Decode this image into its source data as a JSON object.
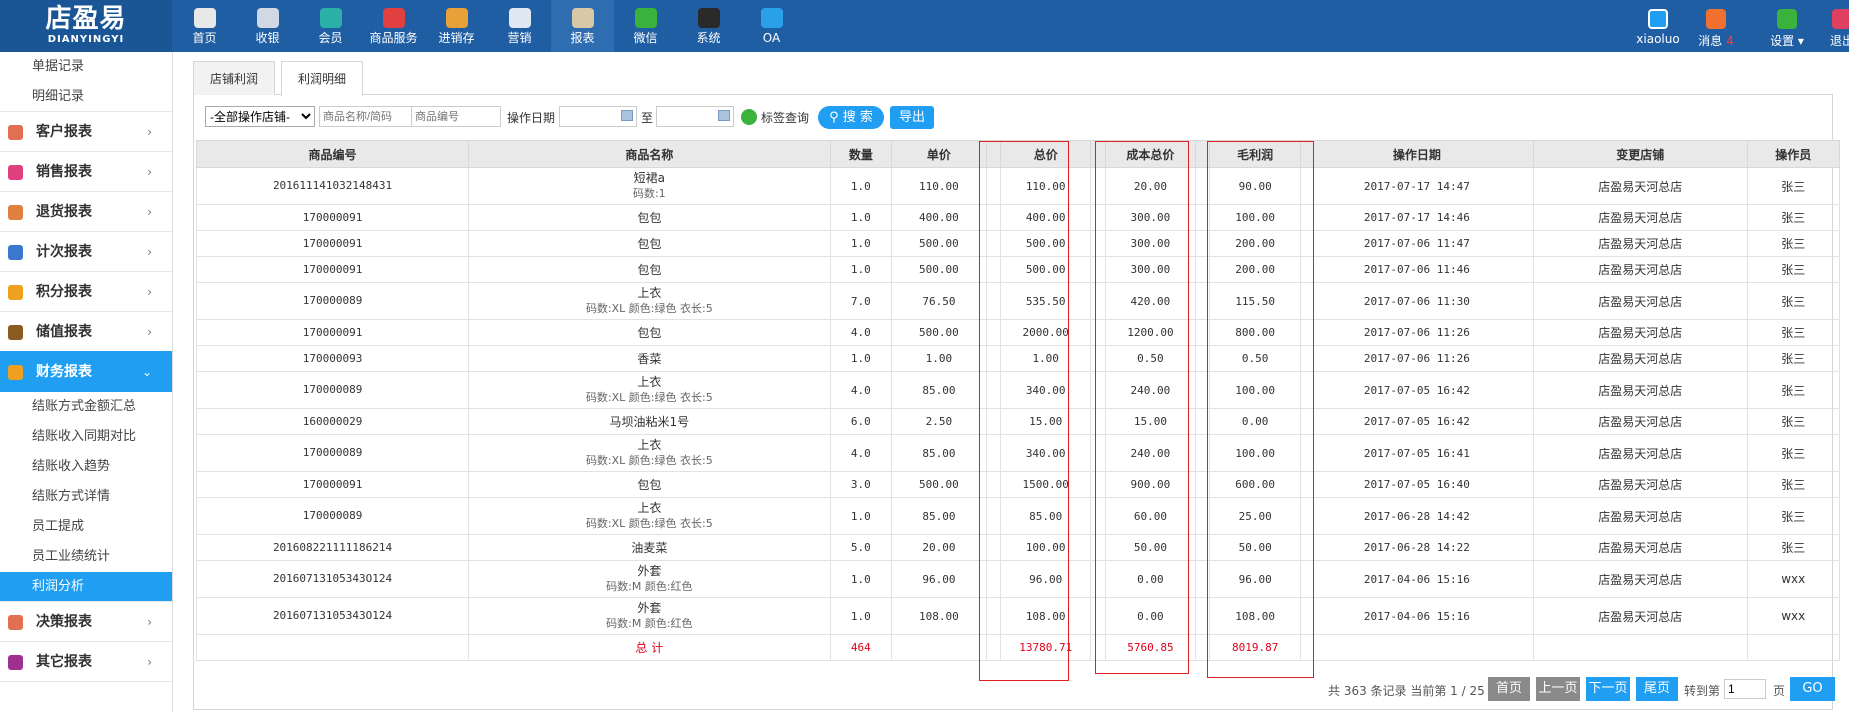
{
  "logo": {
    "cn": "店盈易",
    "en": "DIANYINGYI"
  },
  "nav": [
    {
      "label": "首页",
      "icon": "home-icon",
      "color": "#e8e8e8"
    },
    {
      "label": "收银",
      "icon": "cashier-icon",
      "color": "#cfd8e3"
    },
    {
      "label": "会员",
      "icon": "member-icon",
      "color": "#2bb0a8"
    },
    {
      "label": "商品服务",
      "icon": "goods-icon",
      "color": "#e04040"
    },
    {
      "label": "进销存",
      "icon": "inventory-icon",
      "color": "#e8a038"
    },
    {
      "label": "营销",
      "icon": "megaphone-icon",
      "color": "#dfe8f3"
    },
    {
      "label": "报表",
      "icon": "report-icon",
      "color": "#d8c8a8"
    },
    {
      "label": "微信",
      "icon": "wechat-icon",
      "color": "#3bb23b"
    },
    {
      "label": "系统",
      "icon": "monitor-icon",
      "color": "#2a2a2a"
    },
    {
      "label": "OA",
      "icon": "oa-icon",
      "color": "#2aa0e8"
    }
  ],
  "right": {
    "user": "xiaoluo",
    "msg": "消息",
    "msg_count": "4",
    "settings": "设置",
    "logout": "退出"
  },
  "sidebar": {
    "top_subs": [
      "单据记录",
      "明细记录"
    ],
    "groups": [
      {
        "label": "客户报表",
        "icon": "customer-report-icon",
        "color": "#e07050"
      },
      {
        "label": "销售报表",
        "icon": "sales-report-icon",
        "color": "#e04080"
      },
      {
        "label": "退货报表",
        "icon": "return-report-icon",
        "color": "#e08040"
      },
      {
        "label": "计次报表",
        "icon": "count-report-icon",
        "color": "#3a78d0"
      },
      {
        "label": "积分报表",
        "icon": "points-report-icon",
        "color": "#f0a020"
      },
      {
        "label": "储值报表",
        "icon": "stored-value-report-icon",
        "color": "#8a5a20"
      },
      {
        "label": "财务报表",
        "icon": "finance-report-icon",
        "color": "#f0a020"
      }
    ],
    "finance_subs": [
      "结账方式金额汇总",
      "结账收入同期对比",
      "结账收入趋势",
      "结账方式详情",
      "员工提成",
      "员工业绩统计",
      "利润分析"
    ],
    "bottom_groups": [
      {
        "label": "决策报表",
        "icon": "decision-report-icon",
        "color": "#e07050"
      },
      {
        "label": "其它报表",
        "icon": "other-report-icon",
        "color": "#a03090"
      }
    ]
  },
  "tabs": [
    "店铺利润",
    "利润明细"
  ],
  "filter": {
    "store": "-全部操作店铺-",
    "name_ph": "商品名称/简码",
    "code_ph": "商品编号",
    "date_label": "操作日期",
    "to": "至",
    "tag": "标签查询",
    "search": "搜 索",
    "export": "导出"
  },
  "table": {
    "headers": [
      "商品编号",
      "商品名称",
      "数量",
      "单价",
      "",
      "总价",
      "",
      "成本总价",
      "",
      "毛利润",
      "操作日期",
      "变更店铺",
      "操作员"
    ],
    "rows": [
      {
        "code": "201611141032148431",
        "name": "短裙a",
        "note": "码数:1",
        "qty": "1.0",
        "price": "110.00",
        "total": "110.00",
        "cost": "20.00",
        "profit": "90.00",
        "date": "2017-07-17 14:47",
        "store": "店盈易天河总店",
        "op": "张三"
      },
      {
        "code": "170000091",
        "name": "包包",
        "note": "",
        "qty": "1.0",
        "price": "400.00",
        "total": "400.00",
        "cost": "300.00",
        "profit": "100.00",
        "date": "2017-07-17 14:46",
        "store": "店盈易天河总店",
        "op": "张三"
      },
      {
        "code": "170000091",
        "name": "包包",
        "note": "",
        "qty": "1.0",
        "price": "500.00",
        "total": "500.00",
        "cost": "300.00",
        "profit": "200.00",
        "date": "2017-07-06 11:47",
        "store": "店盈易天河总店",
        "op": "张三"
      },
      {
        "code": "170000091",
        "name": "包包",
        "note": "",
        "qty": "1.0",
        "price": "500.00",
        "total": "500.00",
        "cost": "300.00",
        "profit": "200.00",
        "date": "2017-07-06 11:46",
        "store": "店盈易天河总店",
        "op": "张三"
      },
      {
        "code": "170000089",
        "name": "上衣",
        "note": "码数:XL 颜色:绿色 衣长:5",
        "qty": "7.0",
        "price": "76.50",
        "total": "535.50",
        "cost": "420.00",
        "profit": "115.50",
        "date": "2017-07-06 11:30",
        "store": "店盈易天河总店",
        "op": "张三"
      },
      {
        "code": "170000091",
        "name": "包包",
        "note": "",
        "qty": "4.0",
        "price": "500.00",
        "total": "2000.00",
        "cost": "1200.00",
        "profit": "800.00",
        "date": "2017-07-06 11:26",
        "store": "店盈易天河总店",
        "op": "张三"
      },
      {
        "code": "170000093",
        "name": "香菜",
        "note": "",
        "qty": "1.0",
        "price": "1.00",
        "total": "1.00",
        "cost": "0.50",
        "profit": "0.50",
        "date": "2017-07-06 11:26",
        "store": "店盈易天河总店",
        "op": "张三"
      },
      {
        "code": "170000089",
        "name": "上衣",
        "note": "码数:XL 颜色:绿色 衣长:5",
        "qty": "4.0",
        "price": "85.00",
        "total": "340.00",
        "cost": "240.00",
        "profit": "100.00",
        "date": "2017-07-05 16:42",
        "store": "店盈易天河总店",
        "op": "张三"
      },
      {
        "code": "160000029",
        "name": "马坝油粘米1号",
        "note": "",
        "qty": "6.0",
        "price": "2.50",
        "total": "15.00",
        "cost": "15.00",
        "profit": "0.00",
        "date": "2017-07-05 16:42",
        "store": "店盈易天河总店",
        "op": "张三"
      },
      {
        "code": "170000089",
        "name": "上衣",
        "note": "码数:XL 颜色:绿色 衣长:5",
        "qty": "4.0",
        "price": "85.00",
        "total": "340.00",
        "cost": "240.00",
        "profit": "100.00",
        "date": "2017-07-05 16:41",
        "store": "店盈易天河总店",
        "op": "张三"
      },
      {
        "code": "170000091",
        "name": "包包",
        "note": "",
        "qty": "3.0",
        "price": "500.00",
        "total": "1500.00",
        "cost": "900.00",
        "profit": "600.00",
        "date": "2017-07-05 16:40",
        "store": "店盈易天河总店",
        "op": "张三"
      },
      {
        "code": "170000089",
        "name": "上衣",
        "note": "码数:XL 颜色:绿色 衣长:5",
        "qty": "1.0",
        "price": "85.00",
        "total": "85.00",
        "cost": "60.00",
        "profit": "25.00",
        "date": "2017-06-28 14:42",
        "store": "店盈易天河总店",
        "op": "张三"
      },
      {
        "code": "201608221111186214",
        "name": "油麦菜",
        "note": "",
        "qty": "5.0",
        "price": "20.00",
        "total": "100.00",
        "cost": "50.00",
        "profit": "50.00",
        "date": "2017-06-28 14:22",
        "store": "店盈易天河总店",
        "op": "张三"
      },
      {
        "code": "20160713105343O124",
        "name": "外套",
        "note": "码数:M 颜色:红色",
        "qty": "1.0",
        "price": "96.00",
        "total": "96.00",
        "cost": "0.00",
        "profit": "96.00",
        "date": "2017-04-06 15:16",
        "store": "店盈易天河总店",
        "op": "wxx"
      },
      {
        "code": "20160713105343O124",
        "name": "外套",
        "note": "码数:M 颜色:红色",
        "qty": "1.0",
        "price": "108.00",
        "total": "108.00",
        "cost": "0.00",
        "profit": "108.00",
        "date": "2017-04-06 15:16",
        "store": "店盈易天河总店",
        "op": "wxx"
      }
    ],
    "total": {
      "label": "总 计",
      "qty": "464",
      "total": "13780.71",
      "cost": "5760.85",
      "profit": "8019.87"
    }
  },
  "pager": {
    "info": "共 363 条记录 当前第 1 / 25",
    "first": "首页",
    "prev": "上一页",
    "next": "下一页",
    "last": "尾页",
    "goto": "转到第",
    "page_value": "1",
    "page_unit": "页",
    "go": "GO"
  }
}
